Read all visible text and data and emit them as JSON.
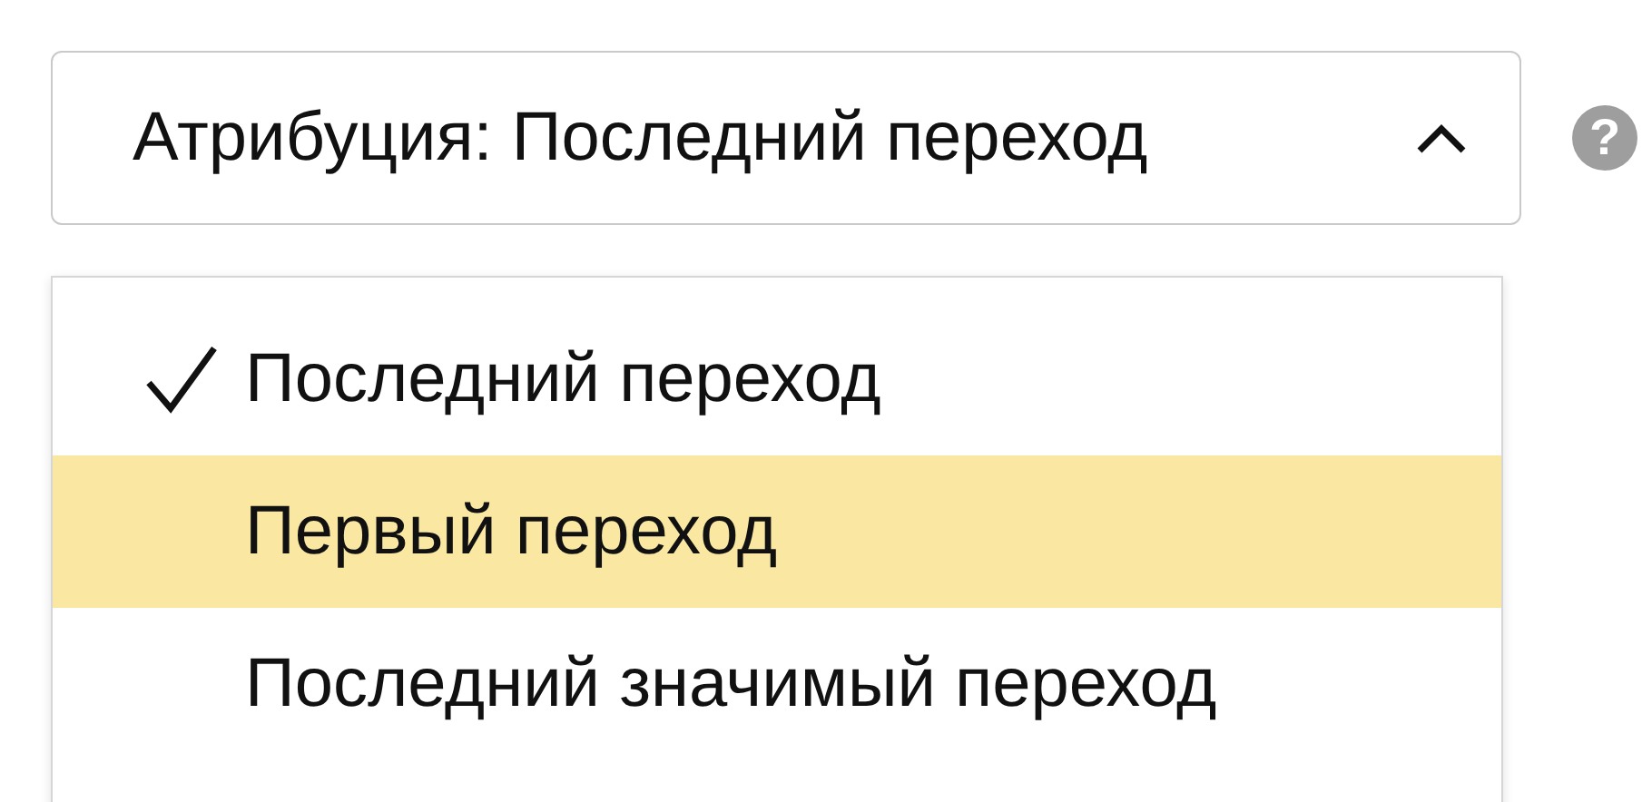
{
  "dropdown": {
    "label": "Атрибуция: Последний переход",
    "expanded": true
  },
  "help": {
    "symbol": "?"
  },
  "menu": {
    "items": [
      {
        "label": "Последний переход",
        "selected": true,
        "highlighted": false
      },
      {
        "label": "Первый переход",
        "selected": false,
        "highlighted": true
      },
      {
        "label": "Последний значимый переход",
        "selected": false,
        "highlighted": false
      }
    ]
  }
}
